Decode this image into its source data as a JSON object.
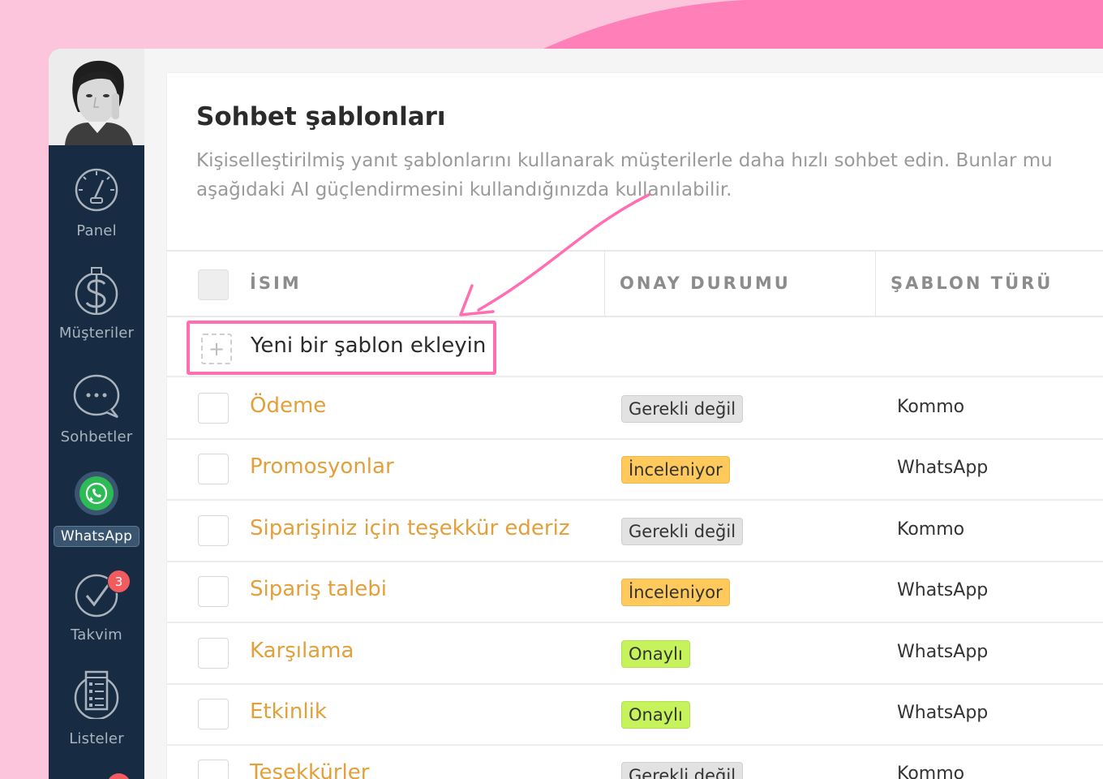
{
  "sidebar": {
    "items": [
      {
        "label": "Panel",
        "icon": "speedometer-icon"
      },
      {
        "label": "Müşteriler",
        "icon": "dollar-icon"
      },
      {
        "label": "Sohbetler",
        "icon": "chat-bubble-icon"
      },
      {
        "label": "WhatsApp",
        "icon": "whatsapp-icon"
      },
      {
        "label": "Takvim",
        "icon": "checkmark-circle-icon",
        "badge": "3"
      },
      {
        "label": "Listeler",
        "icon": "list-icon"
      }
    ]
  },
  "page": {
    "title": "Sohbet şablonları",
    "description": "Kişiselleştirilmiş yanıt şablonlarını kullanarak müşterilerle daha hızlı sohbet edin. Bunlar mu\naşağıdaki AI güçlendirmesini kullandığınızda kullanılabilir."
  },
  "table": {
    "headers": [
      "İSIM",
      "ONAY DURUMU",
      "ŞABLON TÜRÜ"
    ],
    "add_label": "Yeni bir şablon ekleyin",
    "rows": [
      {
        "name": "Ödeme",
        "status": "Gerekli değil",
        "type": "Kommo"
      },
      {
        "name": "Promosyonlar",
        "status": "İnceleniyor",
        "type": "WhatsApp"
      },
      {
        "name": "Siparişiniz için teşekkür ederiz",
        "status": "Gerekli değil",
        "type": "Kommo"
      },
      {
        "name": "Sipariş talebi",
        "status": "İnceleniyor",
        "type": "WhatsApp"
      },
      {
        "name": "Karşılama",
        "status": "Onaylı",
        "type": "WhatsApp"
      },
      {
        "name": "Etkinlik",
        "status": "Onaylı",
        "type": "WhatsApp"
      },
      {
        "name": "Teşekkürler",
        "status": "Gerekli değil",
        "type": "Kommo"
      }
    ]
  },
  "colors": {
    "accent_pink": "#ff6db2",
    "status_not_required": "#e2e2e2",
    "status_reviewing": "#ffc95c",
    "status_approved": "#c6f35c",
    "template_name": "#e3a03a",
    "sidebar_bg": "#172c42"
  }
}
